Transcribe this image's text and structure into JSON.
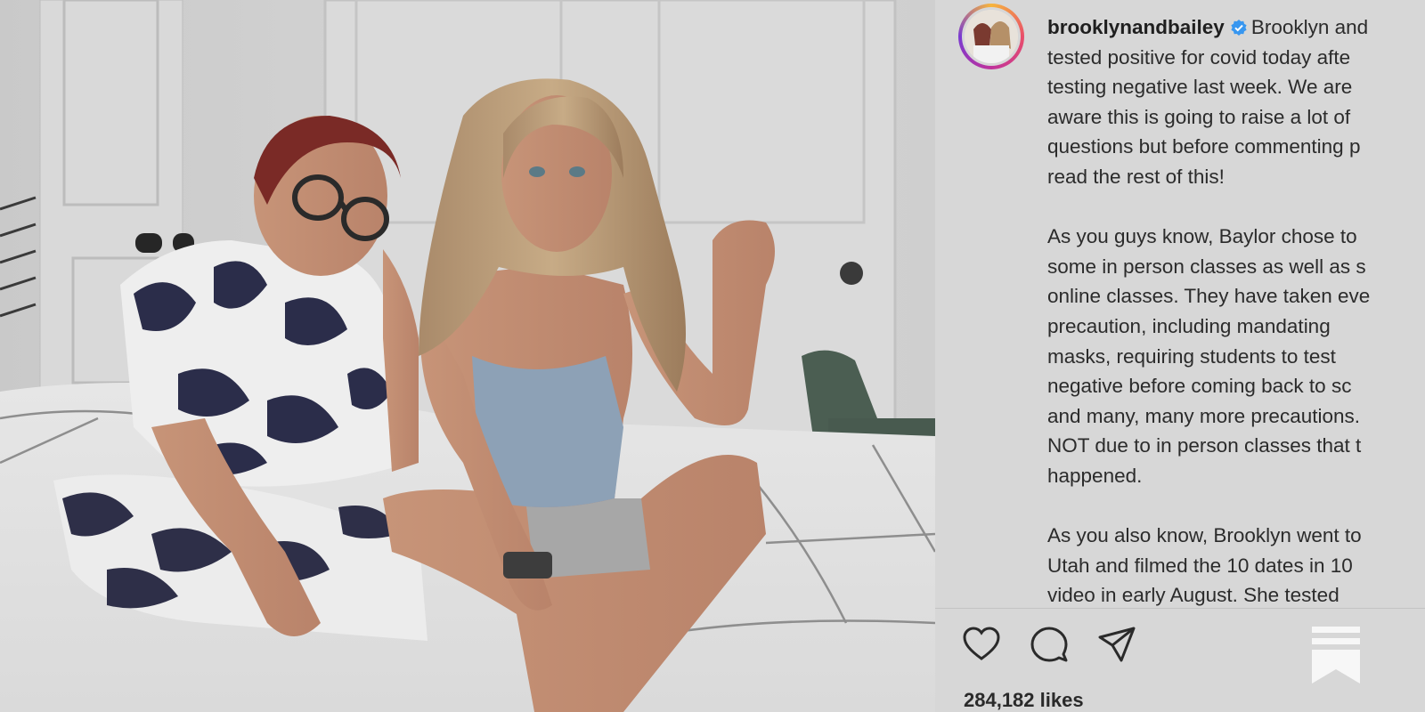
{
  "post": {
    "username": "brooklynandbailey",
    "verified_icon": "verified-badge-icon",
    "caption_lines_p1": [
      "Brooklyn and",
      "tested positive for covid today afte",
      "testing negative last week. We are",
      "aware this is going to raise a lot of",
      "questions but before commenting p",
      "read the rest of this!"
    ],
    "caption_lines_p2": [
      "As you guys know, Baylor chose to",
      "some in person classes as well as s",
      "online classes. They have taken eve",
      "precaution, including mandating",
      "masks, requiring students to test",
      "negative before coming back to sc",
      "and many, many more precautions.",
      "NOT due to in person classes that t",
      "happened."
    ],
    "caption_lines_p3": [
      "As you also know, Brooklyn went to",
      "Utah and filmed the 10 dates in 10",
      "video in early August. She tested"
    ],
    "likes": "284,182 likes"
  },
  "actions": {
    "like_icon": "heart-icon",
    "comment_icon": "comment-icon",
    "share_icon": "paper-plane-icon",
    "logo_icon": "bookmark-logo-icon"
  },
  "colors": {
    "panel_bg": "#d7d7d7",
    "text": "#2b2b2b",
    "verified_blue": "#3897f0"
  }
}
